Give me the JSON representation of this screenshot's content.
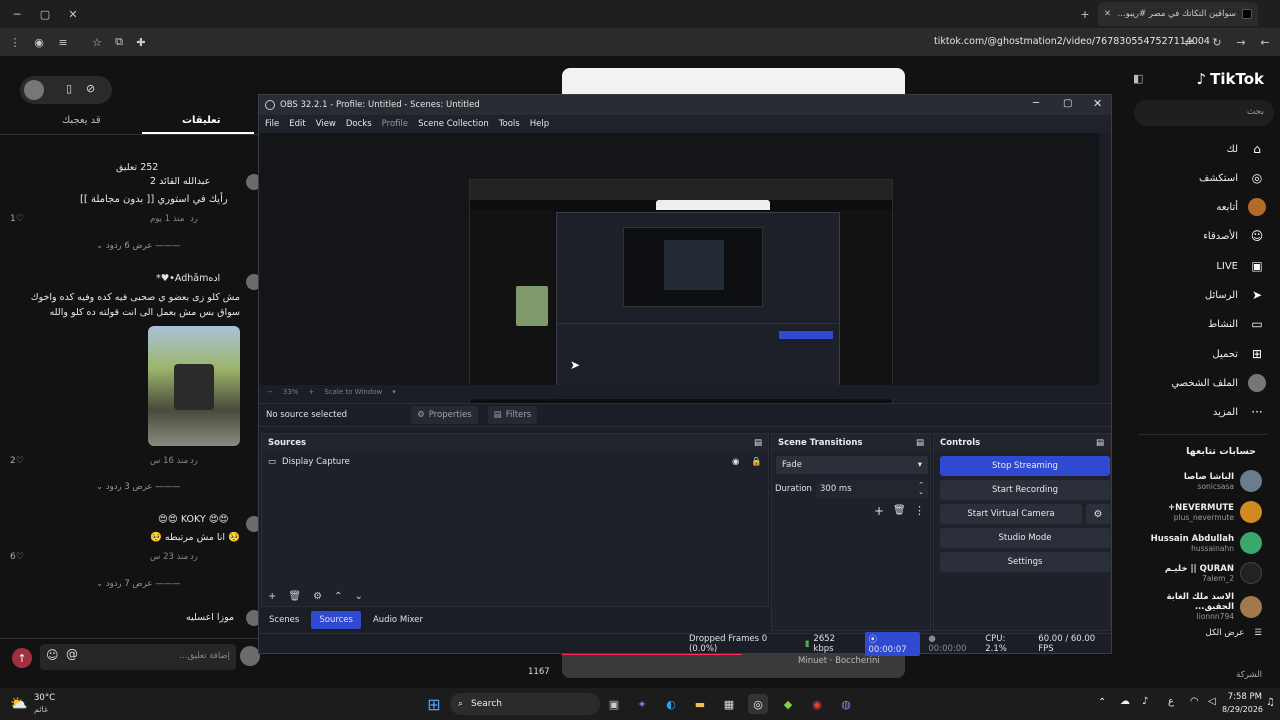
{
  "browser": {
    "tab_title": "سواقين التكاتك في مصر #ريبو...",
    "tab_close": "✕",
    "new_tab": "+",
    "url": "tiktok.com/@ghostmation2/video/7678305547527114004"
  },
  "tiktok": {
    "logo": "TikTok",
    "search_placeholder": "بحث",
    "nav": [
      {
        "label": "لك",
        "icon": "home-icon",
        "glyph": "⌂"
      },
      {
        "label": "استكشف",
        "icon": "compass-icon",
        "glyph": "◎"
      },
      {
        "label": "أتابعه",
        "icon": "following-icon",
        "glyph": "●"
      },
      {
        "label": "الأصدقاء",
        "icon": "friends-icon",
        "glyph": "☺"
      },
      {
        "label": "LIVE",
        "icon": "live-icon",
        "glyph": "▣"
      },
      {
        "label": "الرسائل",
        "icon": "messages-icon",
        "glyph": "➤"
      },
      {
        "label": "النشاط",
        "icon": "activity-icon",
        "glyph": "▭"
      },
      {
        "label": "تحميل",
        "icon": "upload-icon",
        "glyph": "⊞"
      },
      {
        "label": "الملف الشخصي",
        "icon": "profile-icon",
        "glyph": "●"
      },
      {
        "label": "المزيد",
        "icon": "more-icon",
        "glyph": "···"
      }
    ],
    "following_title": "حسابات تتابعها",
    "following": [
      {
        "name": "الباشا صاصا",
        "handle": "sonicsasa"
      },
      {
        "name": "NEVERMUTE+",
        "handle": "plus_nevermute"
      },
      {
        "name": "Hussain Abdullah",
        "handle": "hussainahn"
      },
      {
        "name": "QURAN || خليـم",
        "handle": "7alem_2"
      },
      {
        "name": "الاسد ملك الغابة الحقيق...",
        "handle": "lionnn794"
      }
    ],
    "see_all": "عرض الكل",
    "company": "الشركة",
    "comments_tab": "تعليقات",
    "you_may_like_tab": "قد يعجبك",
    "comments_count": "252 تعليق",
    "comments": [
      {
        "user": "عبدالله القائد 2",
        "text": "رأيك في استوري [[ بدون مجاملة ]]",
        "time": "منذ 1 يوم",
        "reply": "رد",
        "likes": "1",
        "view_replies": "عرض 6 ردود"
      },
      {
        "user": "ادهAdhām•♥*",
        "text": "مش كلو زى بعضو ي صحبى فيه كده وفيه كده واخوك سواق بس مش بعمل الى انت قولته ده كلو والله",
        "time": "منذ 16 س",
        "reply": "رد",
        "likes": "2",
        "view_replies": "عرض 3 ردود"
      },
      {
        "user": "KOKY",
        "text": "انا مش مرتبطه",
        "time": "منذ 23 س",
        "reply": "رد",
        "likes": "6",
        "view_replies": "عرض 7 ردود"
      },
      {
        "user": "موزا اعسليه"
      }
    ],
    "comment_placeholder": "إضافة تعليق...",
    "at_sign": "@",
    "video_count": "1167",
    "music_text": "Minuet · Boccherini"
  },
  "obs": {
    "title": "OBS 32.2.1 - Profile: Untitled - Scenes: Untitled",
    "menu": [
      "File",
      "Edit",
      "View",
      "Docks",
      "Profile",
      "Scene Collection",
      "Tools",
      "Help"
    ],
    "zoom": "33%",
    "scale_mode": "Scale to Window",
    "no_source": "No source selected",
    "properties": "Properties",
    "filters": "Filters",
    "sources_title": "Sources",
    "source_item": "Display Capture",
    "transitions_title": "Scene Transitions",
    "transition": "Fade",
    "duration_label": "Duration",
    "duration_value": "300 ms",
    "controls_title": "Controls",
    "btn_stream": "Stop Streaming",
    "btn_record": "Start Recording",
    "btn_vcam": "Start Virtual Camera",
    "btn_studio": "Studio Mode",
    "btn_settings": "Settings",
    "tabs": [
      "Scenes",
      "Sources",
      "Audio Mixer"
    ],
    "active_tab": "Sources",
    "status": {
      "dropped": "Dropped Frames 0 (0.0%)",
      "bitrate": "2652 kbps",
      "stream_time": "00:00:07",
      "rec_time": "00:00:00",
      "cpu": "CPU: 2.1%",
      "fps": "60.00 / 60.00 FPS"
    },
    "colors": {
      "accent": "#2f4ad1",
      "bg": "#1b1e26",
      "panel": "#1e2129"
    }
  },
  "taskbar": {
    "temp": "30°C",
    "weather": "غائم",
    "search": "Search",
    "time": "7:58 PM",
    "date": "8/29/2026",
    "lang": "ع"
  }
}
